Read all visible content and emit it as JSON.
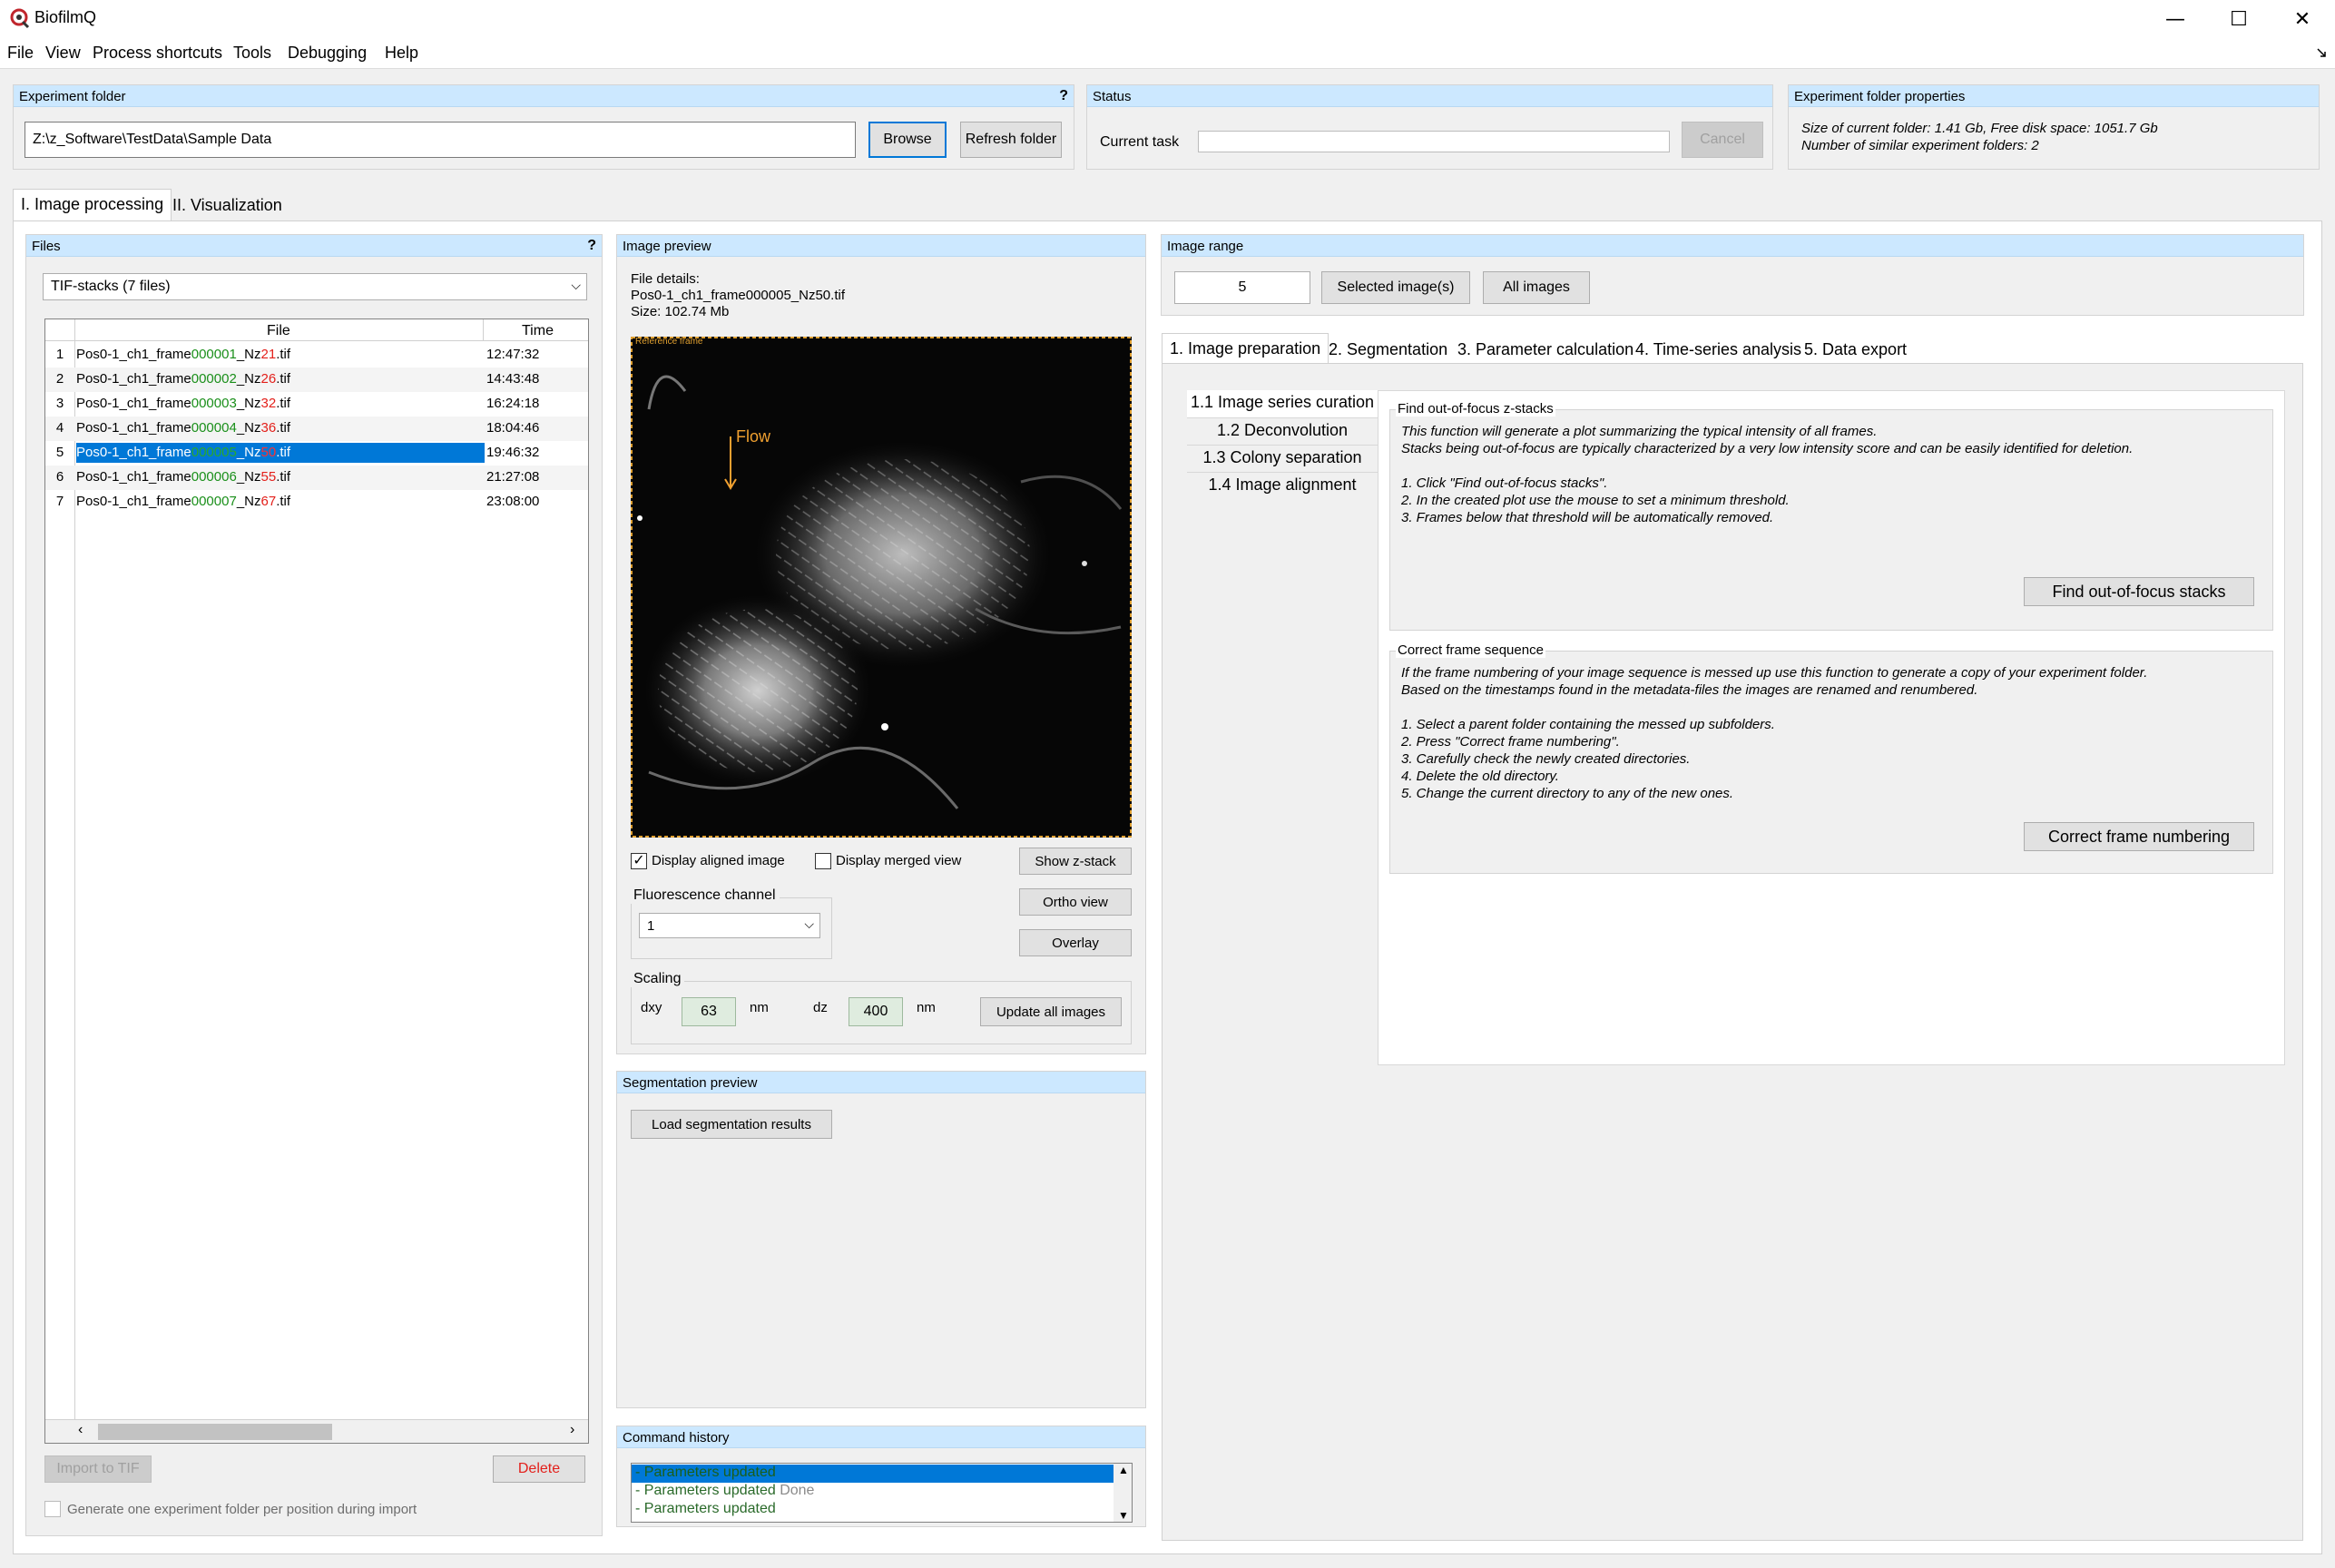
{
  "app": {
    "title": "BiofilmQ"
  },
  "window": {
    "minimize": "—",
    "maximize": "☐",
    "close": "✕"
  },
  "menu": [
    "File",
    "View",
    "Process shortcuts",
    "Tools",
    "Debugging",
    "Help"
  ],
  "experiment_folder": {
    "header": "Experiment folder",
    "help": "?",
    "path": "Z:\\z_Software\\TestData\\Sample Data",
    "browse": "Browse",
    "refresh": "Refresh folder"
  },
  "status": {
    "header": "Status",
    "current_task_label": "Current task",
    "cancel": "Cancel"
  },
  "folder_properties": {
    "header": "Experiment folder properties",
    "line1": "Size of current folder: 1.41 Gb, Free disk space: 1051.7 Gb",
    "line2": "Number of similar experiment folders: 2"
  },
  "main_tabs": [
    "I. Image processing",
    "II. Visualization"
  ],
  "files": {
    "header": "Files",
    "help": "?",
    "filter": "TIF-stacks (7 files)",
    "col_file": "File",
    "col_time": "Time",
    "rows": [
      {
        "idx": "1",
        "prefix": "Pos0-1_ch1_frame",
        "frame": "000001",
        "nz": "_Nz",
        "nzval": "21",
        "ext": ".tif",
        "time": "12:47:32"
      },
      {
        "idx": "2",
        "prefix": "Pos0-1_ch1_frame",
        "frame": "000002",
        "nz": "_Nz",
        "nzval": "26",
        "ext": ".tif",
        "time": "14:43:48"
      },
      {
        "idx": "3",
        "prefix": "Pos0-1_ch1_frame",
        "frame": "000003",
        "nz": "_Nz",
        "nzval": "32",
        "ext": ".tif",
        "time": "16:24:18"
      },
      {
        "idx": "4",
        "prefix": "Pos0-1_ch1_frame",
        "frame": "000004",
        "nz": "_Nz",
        "nzval": "36",
        "ext": ".tif",
        "time": "18:04:46"
      },
      {
        "idx": "5",
        "prefix": "Pos0-1_ch1_frame",
        "frame": "000005",
        "nz": "_Nz",
        "nzval": "50",
        "ext": ".tif",
        "time": "19:46:32"
      },
      {
        "idx": "6",
        "prefix": "Pos0-1_ch1_frame",
        "frame": "000006",
        "nz": "_Nz",
        "nzval": "55",
        "ext": ".tif",
        "time": "21:27:08"
      },
      {
        "idx": "7",
        "prefix": "Pos0-1_ch1_frame",
        "frame": "000007",
        "nz": "_Nz",
        "nzval": "67",
        "ext": ".tif",
        "time": "23:08:00"
      }
    ],
    "import_btn": "Import to TIF",
    "delete_btn": "Delete",
    "generate_checkbox": "Generate one experiment folder per position during import"
  },
  "image_preview": {
    "header": "Image preview",
    "details_label": "File details:",
    "details_file": "Pos0-1_ch1_frame000005_Nz50.tif",
    "details_size": "Size: 102.74 Mb",
    "ref_label": "Reference frame",
    "flow_label": "Flow",
    "display_aligned": "Display aligned image",
    "display_merged": "Display merged view",
    "show_zstack": "Show z-stack",
    "ortho_view": "Ortho view",
    "overlay": "Overlay",
    "fluor_label": "Fluorescence channel",
    "fluor_value": "1",
    "scaling_label": "Scaling",
    "dxy_label": "dxy",
    "dxy_value": "63",
    "dxy_unit": "nm",
    "dz_label": "dz",
    "dz_value": "400",
    "dz_unit": "nm",
    "update_all": "Update all images"
  },
  "segmentation_preview": {
    "header": "Segmentation preview",
    "load_btn": "Load segmentation results"
  },
  "command_history": {
    "header": "Command history",
    "items": [
      {
        "text": "- Parameters updated",
        "suffix": ""
      },
      {
        "text": "- Parameters updated",
        "suffix": " Done"
      },
      {
        "text": "- Parameters updated",
        "suffix": ""
      }
    ]
  },
  "image_range": {
    "header": "Image range",
    "value": "5",
    "selected_btn": "Selected image(s)",
    "all_btn": "All images"
  },
  "process_tabs": [
    "1. Image preparation",
    "2. Segmentation",
    "3. Parameter calculation",
    "4. Time-series analysis",
    "5. Data export"
  ],
  "side_nav": [
    "1.1 Image series curation",
    "1.2 Deconvolution",
    "1.3 Colony separation",
    "1.4 Image alignment"
  ],
  "out_of_focus": {
    "title": "Find out-of-focus z-stacks",
    "lines": [
      "This function will generate a plot summarizing the typical intensity of all frames.",
      "Stacks being out-of-focus are typically characterized by a very low intensity score and can be easily identified for deletion.",
      "",
      "1. Click \"Find out-of-focus stacks\".",
      "2. In the created plot use the mouse to set a minimum threshold.",
      "3. Frames below that threshold will be automatically removed."
    ],
    "button": "Find out-of-focus stacks"
  },
  "frame_sequence": {
    "title": "Correct frame sequence",
    "lines": [
      "If the frame numbering of your image sequence is messed up use this function to generate a copy of your experiment folder.",
      "Based on the timestamps found in the metadata-files the images are renamed and renumbered.",
      "",
      "1. Select a parent folder containing the messed up subfolders.",
      "2. Press \"Correct frame numbering\".",
      "3. Carefully check the newly created directories.",
      "4. Delete the old directory.",
      "5. Change the current directory to any of the new ones."
    ],
    "button": "Correct frame numbering"
  }
}
